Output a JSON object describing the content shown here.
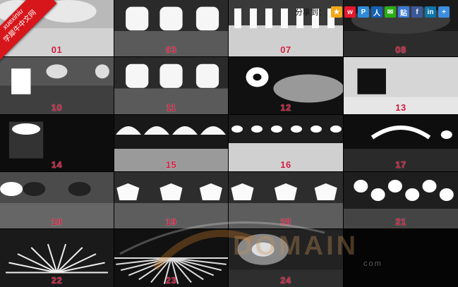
{
  "brand_ribbon": {
    "site": "xuexiniu",
    "name": "学犀牛中文网"
  },
  "share": {
    "label": "分享到：",
    "icons": [
      {
        "name": "qzone-icon",
        "glyph": "★",
        "color": "#f0a91a"
      },
      {
        "name": "weibo-icon",
        "glyph": "w",
        "color": "#e6162d"
      },
      {
        "name": "pengyou-icon",
        "glyph": "P",
        "color": "#2e8ad8"
      },
      {
        "name": "renren-icon",
        "glyph": "人",
        "color": "#1562b3"
      },
      {
        "name": "wechat-icon",
        "glyph": "✉",
        "color": "#2aae16"
      },
      {
        "name": "tieba-icon",
        "glyph": "贴",
        "color": "#3a7ad6"
      },
      {
        "name": "facebook-icon",
        "glyph": "f",
        "color": "#3b5998"
      },
      {
        "name": "linkedin-icon",
        "glyph": "in",
        "color": "#0e76a8"
      },
      {
        "name": "more-icon",
        "glyph": "+",
        "color": "#3c8ee0"
      }
    ]
  },
  "tiles": [
    {
      "label": "01",
      "style": "soft"
    },
    {
      "label": "03",
      "style": "panels"
    },
    {
      "label": "07",
      "style": "studio"
    },
    {
      "label": "08",
      "style": "dark"
    },
    {
      "label": "10",
      "style": "windows"
    },
    {
      "label": "11",
      "style": "panels"
    },
    {
      "label": "12",
      "style": "ring"
    },
    {
      "label": "13",
      "style": "room"
    },
    {
      "label": "14",
      "style": "box"
    },
    {
      "label": "15",
      "style": "arches"
    },
    {
      "label": "16",
      "style": "strip"
    },
    {
      "label": "17",
      "style": "arcs"
    },
    {
      "label": "18",
      "style": "softdark"
    },
    {
      "label": "19",
      "style": "hex"
    },
    {
      "label": "20",
      "style": "hex"
    },
    {
      "label": "21",
      "style": "hexrow"
    },
    {
      "label": "22",
      "style": "fan"
    },
    {
      "label": "23",
      "style": "fanwide"
    },
    {
      "label": "24",
      "style": "glow"
    },
    {
      "label": "",
      "style": "empty"
    }
  ],
  "watermark": {
    "text": "DOMAIN",
    "sub": "com"
  }
}
